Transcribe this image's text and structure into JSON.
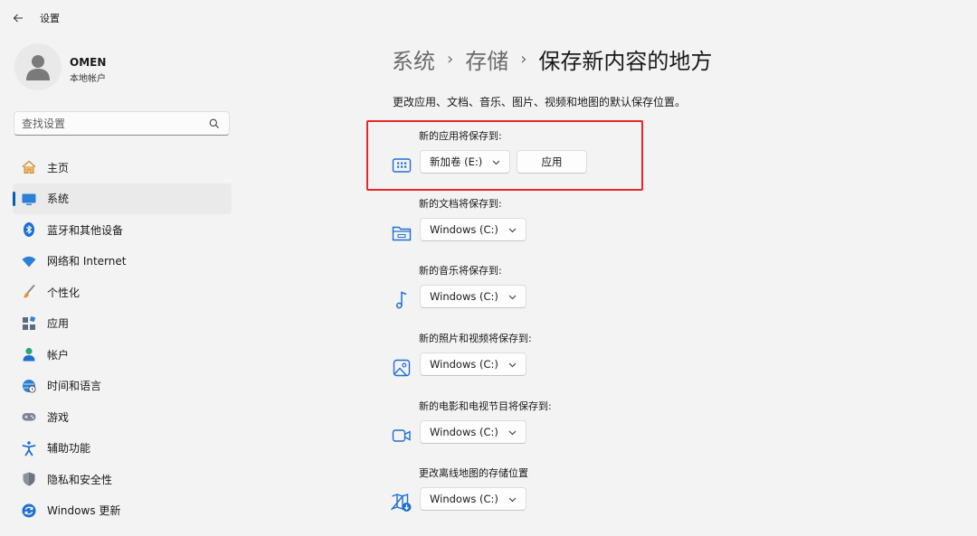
{
  "app": {
    "title": "设置"
  },
  "profile": {
    "name": "OMEN",
    "account_type": "本地帐户"
  },
  "search": {
    "placeholder": "查找设置"
  },
  "sidebar": {
    "items": [
      {
        "label": "主页",
        "icon": "home-icon"
      },
      {
        "label": "系统",
        "icon": "monitor-icon",
        "active": true
      },
      {
        "label": "蓝牙和其他设备",
        "icon": "bluetooth-icon"
      },
      {
        "label": "网络和 Internet",
        "icon": "wifi-icon"
      },
      {
        "label": "个性化",
        "icon": "brush-icon"
      },
      {
        "label": "应用",
        "icon": "apps-icon"
      },
      {
        "label": "帐户",
        "icon": "person-icon"
      },
      {
        "label": "时间和语言",
        "icon": "globe-clock-icon"
      },
      {
        "label": "游戏",
        "icon": "gamepad-icon"
      },
      {
        "label": "辅助功能",
        "icon": "accessibility-icon"
      },
      {
        "label": "隐私和安全性",
        "icon": "shield-icon"
      },
      {
        "label": "Windows 更新",
        "icon": "update-icon"
      }
    ]
  },
  "breadcrumb": [
    "系统",
    "存储",
    "保存新内容的地方"
  ],
  "description": "更改应用、文档、音乐、图片、视频和地图的默认保存位置。",
  "sections": [
    {
      "label": "新的应用将保存到:",
      "icon": "app-storage-icon",
      "selected": "新加卷 (E:)",
      "apply_label": "应用"
    },
    {
      "label": "新的文档将保存到:",
      "icon": "folder-icon",
      "selected": "Windows (C:)"
    },
    {
      "label": "新的音乐将保存到:",
      "icon": "music-note-icon",
      "selected": "Windows (C:)"
    },
    {
      "label": "新的照片和视频将保存到:",
      "icon": "image-icon",
      "selected": "Windows (C:)"
    },
    {
      "label": "新的电影和电视节目将保存到:",
      "icon": "video-camera-icon",
      "selected": "Windows (C:)"
    },
    {
      "label": "更改离线地图的存储位置",
      "icon": "map-download-icon",
      "selected": "Windows (C:)"
    }
  ],
  "colors": {
    "accent": "#005fb8",
    "highlight": "#e8262a",
    "background": "#f3f3f3"
  }
}
